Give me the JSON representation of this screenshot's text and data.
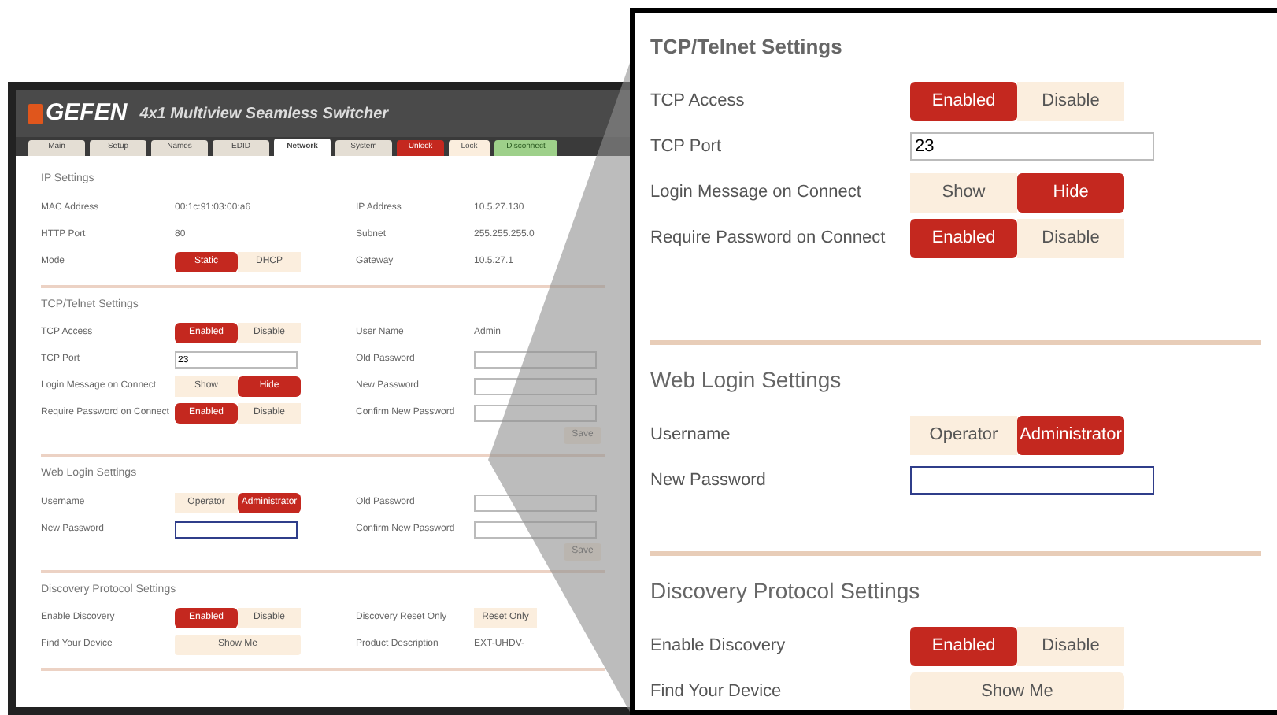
{
  "window": {
    "logo": "GEFEN",
    "title": "4x1 Multiview Seamless Switcher"
  },
  "tabs": [
    {
      "label": "Main",
      "kind": "tab",
      "selected": false
    },
    {
      "label": "Setup",
      "kind": "tab",
      "selected": false
    },
    {
      "label": "Names",
      "kind": "tab",
      "selected": false
    },
    {
      "label": "EDID",
      "kind": "tab",
      "selected": false
    },
    {
      "label": "Network",
      "kind": "tab",
      "selected": true
    },
    {
      "label": "System",
      "kind": "tab",
      "selected": false
    },
    {
      "label": "Unlock",
      "kind": "unlock",
      "selected": false
    },
    {
      "label": "Lock",
      "kind": "lock",
      "selected": false
    },
    {
      "label": "Disconnect",
      "kind": "status",
      "selected": false
    }
  ],
  "sections": [
    {
      "title": "IP Settings",
      "rows": [
        {
          "label": "MAC Address",
          "kind": "text",
          "value": "00:1c:91:03:00:a6"
        },
        {
          "label": "HTTP Port",
          "kind": "text",
          "value": "80"
        },
        {
          "label": "Mode",
          "kind": "toggle",
          "options": [
            {
              "label": "Static",
              "selected": true
            },
            {
              "label": "DHCP",
              "selected": false
            }
          ]
        }
      ],
      "side_rows": [
        {
          "label": "IP Address",
          "kind": "text",
          "value": "10.5.27.130"
        },
        {
          "label": "Subnet",
          "kind": "text",
          "value": "255.255.255.0"
        },
        {
          "label": "Gateway",
          "kind": "text",
          "value": "10.5.27.1"
        }
      ]
    },
    {
      "title": "TCP/Telnet Settings",
      "rows": [
        {
          "label": "TCP Access",
          "kind": "toggle",
          "options": [
            {
              "label": "Enabled",
              "selected": true
            },
            {
              "label": "Disable",
              "selected": false
            }
          ]
        },
        {
          "label": "TCP Port",
          "kind": "field",
          "value": "23"
        },
        {
          "label": "Login Message on Connect",
          "kind": "toggle",
          "options": [
            {
              "label": "Show",
              "selected": false
            },
            {
              "label": "Hide",
              "selected": true
            }
          ]
        },
        {
          "label": "Require Password on Connect",
          "kind": "toggle",
          "options": [
            {
              "label": "Enabled",
              "selected": true
            },
            {
              "label": "Disable",
              "selected": false
            }
          ]
        }
      ],
      "side_rows": [
        {
          "label": "User Name",
          "kind": "text",
          "value": "Admin"
        },
        {
          "label": "Old Password",
          "kind": "field"
        },
        {
          "label": "New Password",
          "kind": "field"
        },
        {
          "label": "Confirm New Password",
          "kind": "field"
        }
      ],
      "action": "Save"
    },
    {
      "title": "Web Login Settings",
      "rows": [
        {
          "label": "Username",
          "kind": "toggle",
          "options": [
            {
              "label": "Operator",
              "selected": false
            },
            {
              "label": "Administrator",
              "selected": true
            }
          ]
        },
        {
          "label": "New Password",
          "kind": "field",
          "focused": true
        }
      ],
      "side_rows": [
        {
          "label": "Old Password",
          "kind": "field"
        },
        {
          "label": "Confirm New Password",
          "kind": "field"
        }
      ],
      "action": "Save"
    },
    {
      "title": "Discovery Protocol Settings",
      "rows": [
        {
          "label": "Enable Discovery",
          "kind": "toggle",
          "options": [
            {
              "label": "Enabled",
              "selected": true
            },
            {
              "label": "Disable",
              "selected": false
            }
          ]
        },
        {
          "label": "Find Your Device",
          "kind": "button",
          "value": "Show Me"
        }
      ],
      "side_rows": [
        {
          "label": "Discovery Reset Only",
          "kind": "toggle",
          "options": [
            {
              "label": "Reset Only",
              "selected": false
            }
          ]
        },
        {
          "label": "Product Description",
          "kind": "text",
          "value": "EXT-UHDV-"
        }
      ]
    }
  ],
  "callout": {
    "sections": [
      {
        "title": "TCP/Telnet Settings",
        "rows": [
          {
            "label": "TCP Access",
            "kind": "toggle",
            "options": [
              {
                "label": "Enabled",
                "selected": true
              },
              {
                "label": "Disable",
                "selected": false
              }
            ]
          },
          {
            "label": "TCP Port",
            "kind": "field",
            "value": "23"
          },
          {
            "label": "Login Message on Connect",
            "kind": "toggle",
            "options": [
              {
                "label": "Show",
                "selected": false
              },
              {
                "label": "Hide",
                "selected": true
              }
            ]
          },
          {
            "label": "Require Password on Connect",
            "kind": "toggle",
            "options": [
              {
                "label": "Enabled",
                "selected": true
              },
              {
                "label": "Disable",
                "selected": false
              }
            ]
          }
        ]
      },
      {
        "title": "Web Login Settings",
        "rows": [
          {
            "label": "Username",
            "kind": "toggle",
            "options": [
              {
                "label": "Operator",
                "selected": false
              },
              {
                "label": "Administrator",
                "selected": true
              }
            ]
          },
          {
            "label": "New Password",
            "kind": "field",
            "focused": true
          }
        ]
      },
      {
        "title": "Discovery Protocol Settings",
        "rows": [
          {
            "label": "Enable Discovery",
            "kind": "toggle",
            "options": [
              {
                "label": "Enabled",
                "selected": true
              },
              {
                "label": "Disable",
                "selected": false
              }
            ]
          },
          {
            "label": "Find Your Device",
            "kind": "button",
            "value": "Show Me"
          }
        ]
      }
    ]
  }
}
